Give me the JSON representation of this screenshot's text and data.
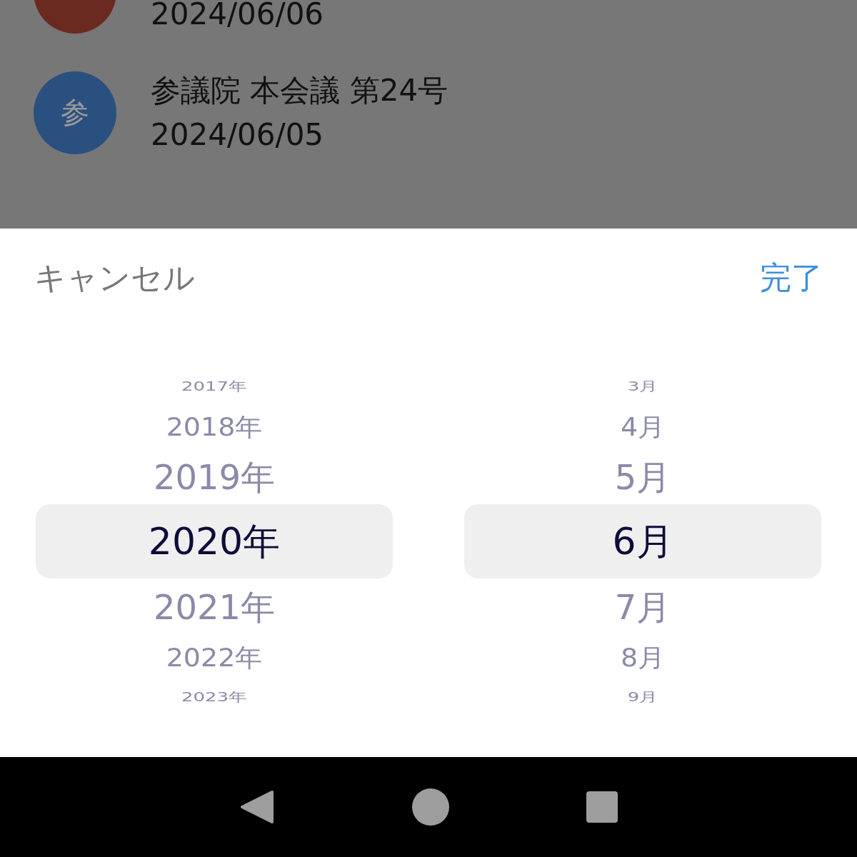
{
  "list": {
    "items": [
      {
        "color": "#6b2a20",
        "date": "2024/06/06"
      },
      {
        "color": "#2a5080",
        "avatar": "参",
        "title": "参議院 本会議 第24号",
        "date": "2024/06/05"
      }
    ]
  },
  "picker": {
    "cancel": "キャンセル",
    "done": "完了",
    "columns": [
      {
        "items": [
          {
            "label": "2017年",
            "selected": false
          },
          {
            "label": "2018年",
            "selected": false
          },
          {
            "label": "2019年",
            "selected": false
          },
          {
            "label": "2020年",
            "selected": true
          },
          {
            "label": "2021年",
            "selected": false
          },
          {
            "label": "2022年",
            "selected": false
          },
          {
            "label": "2023年",
            "selected": false
          }
        ]
      },
      {
        "items": [
          {
            "label": "3月",
            "selected": false
          },
          {
            "label": "4月",
            "selected": false
          },
          {
            "label": "5月",
            "selected": false
          },
          {
            "label": "6月",
            "selected": true
          },
          {
            "label": "7月",
            "selected": false
          },
          {
            "label": "8月",
            "selected": false
          },
          {
            "label": "9月",
            "selected": false
          }
        ]
      }
    ]
  }
}
